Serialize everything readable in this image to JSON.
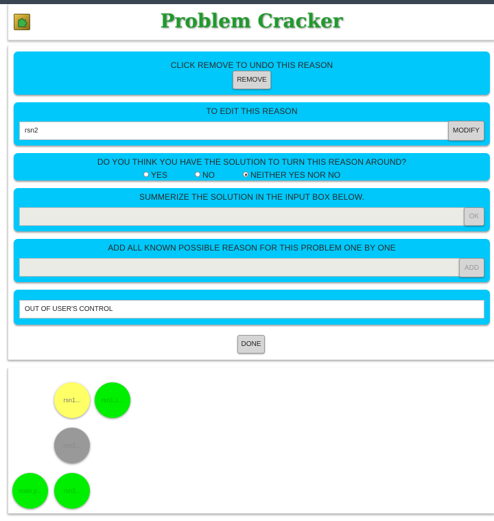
{
  "app": {
    "title": "Problem Cracker",
    "icon": "puzzle-icon"
  },
  "remove_section": {
    "title": "CLICK REMOVE TO UNDO THIS REASON",
    "button": "REMOVE"
  },
  "edit_section": {
    "title": "TO EDIT THIS REASON",
    "value": "rsn2",
    "button": "MODIFY"
  },
  "solution_question": {
    "title": "DO YOU THINK YOU HAVE THE SOLUTION TO TURN THIS REASON AROUND?",
    "options": [
      {
        "label": "YES",
        "checked": false
      },
      {
        "label": "NO",
        "checked": false
      },
      {
        "label": "NEITHER YES NOR NO",
        "checked": true
      }
    ]
  },
  "summarize_section": {
    "title": "SUMMERIZE THE SOLUTION IN THE INPUT BOX BELOW.",
    "value": "",
    "button": "OK"
  },
  "add_reason_section": {
    "title": "ADD ALL KNOWN POSSIBLE REASON FOR THIS PROBLEM ONE BY ONE",
    "value": "",
    "button": "ADD"
  },
  "control_section": {
    "value": "OUT OF USER'S CONTROL"
  },
  "done_button": "DONE",
  "tree": {
    "nodes": [
      {
        "label": "rsn1...",
        "color": "#ffff66",
        "text_color": "#777777"
      },
      {
        "label": "rsn1.1...",
        "color": "#00ee00",
        "text_color": "#00c000"
      },
      {
        "label": "rsn2...",
        "color": "#999999",
        "text_color": "#888888"
      },
      {
        "label": "main p...",
        "color": "#00ee00",
        "text_color": "#00c000"
      },
      {
        "label": "rsn3...",
        "color": "#00ee00",
        "text_color": "#00c000"
      }
    ]
  },
  "colors": {
    "section_bg": "#00c8fa",
    "title_green": "#1f9a2c"
  }
}
